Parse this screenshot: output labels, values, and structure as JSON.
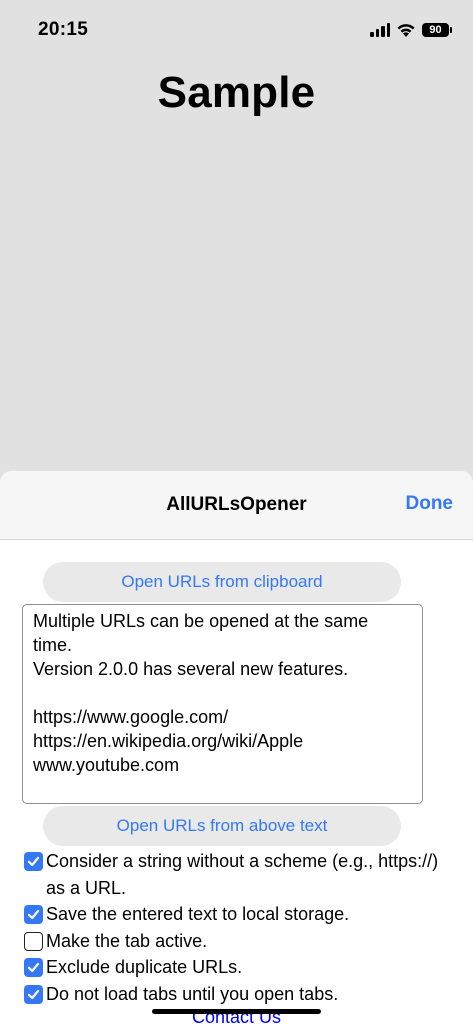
{
  "status_bar": {
    "time": "20:15",
    "battery": "90",
    "icons": [
      "signal-icon",
      "wifi-icon",
      "battery-icon"
    ]
  },
  "page": {
    "title": "Sample"
  },
  "sheet": {
    "title": "AllURLsOpener",
    "done_label": "Done",
    "open_clipboard_label": "Open URLs from clipboard",
    "text_value": "Multiple URLs can be opened at the same time.\nVersion 2.0.0 has several new features.\n\nhttps://www.google.com/\nhttps://en.wikipedia.org/wiki/Apple\nwww.youtube.com",
    "open_above_label": "Open URLs from above text",
    "options": [
      {
        "label": "Consider a string without a scheme (e.g., https://) as a URL.",
        "checked": true
      },
      {
        "label": "Save the entered text to local storage.",
        "checked": true
      },
      {
        "label": "Make the tab active.",
        "checked": false
      },
      {
        "label": "Exclude duplicate URLs.",
        "checked": true
      },
      {
        "label": "Do not load tabs until you open tabs.",
        "checked": true
      }
    ],
    "contact_label": "Contact Us"
  },
  "colors": {
    "accent": "#3478f6",
    "background": "#e1e1e1",
    "link": "#0000ee"
  }
}
